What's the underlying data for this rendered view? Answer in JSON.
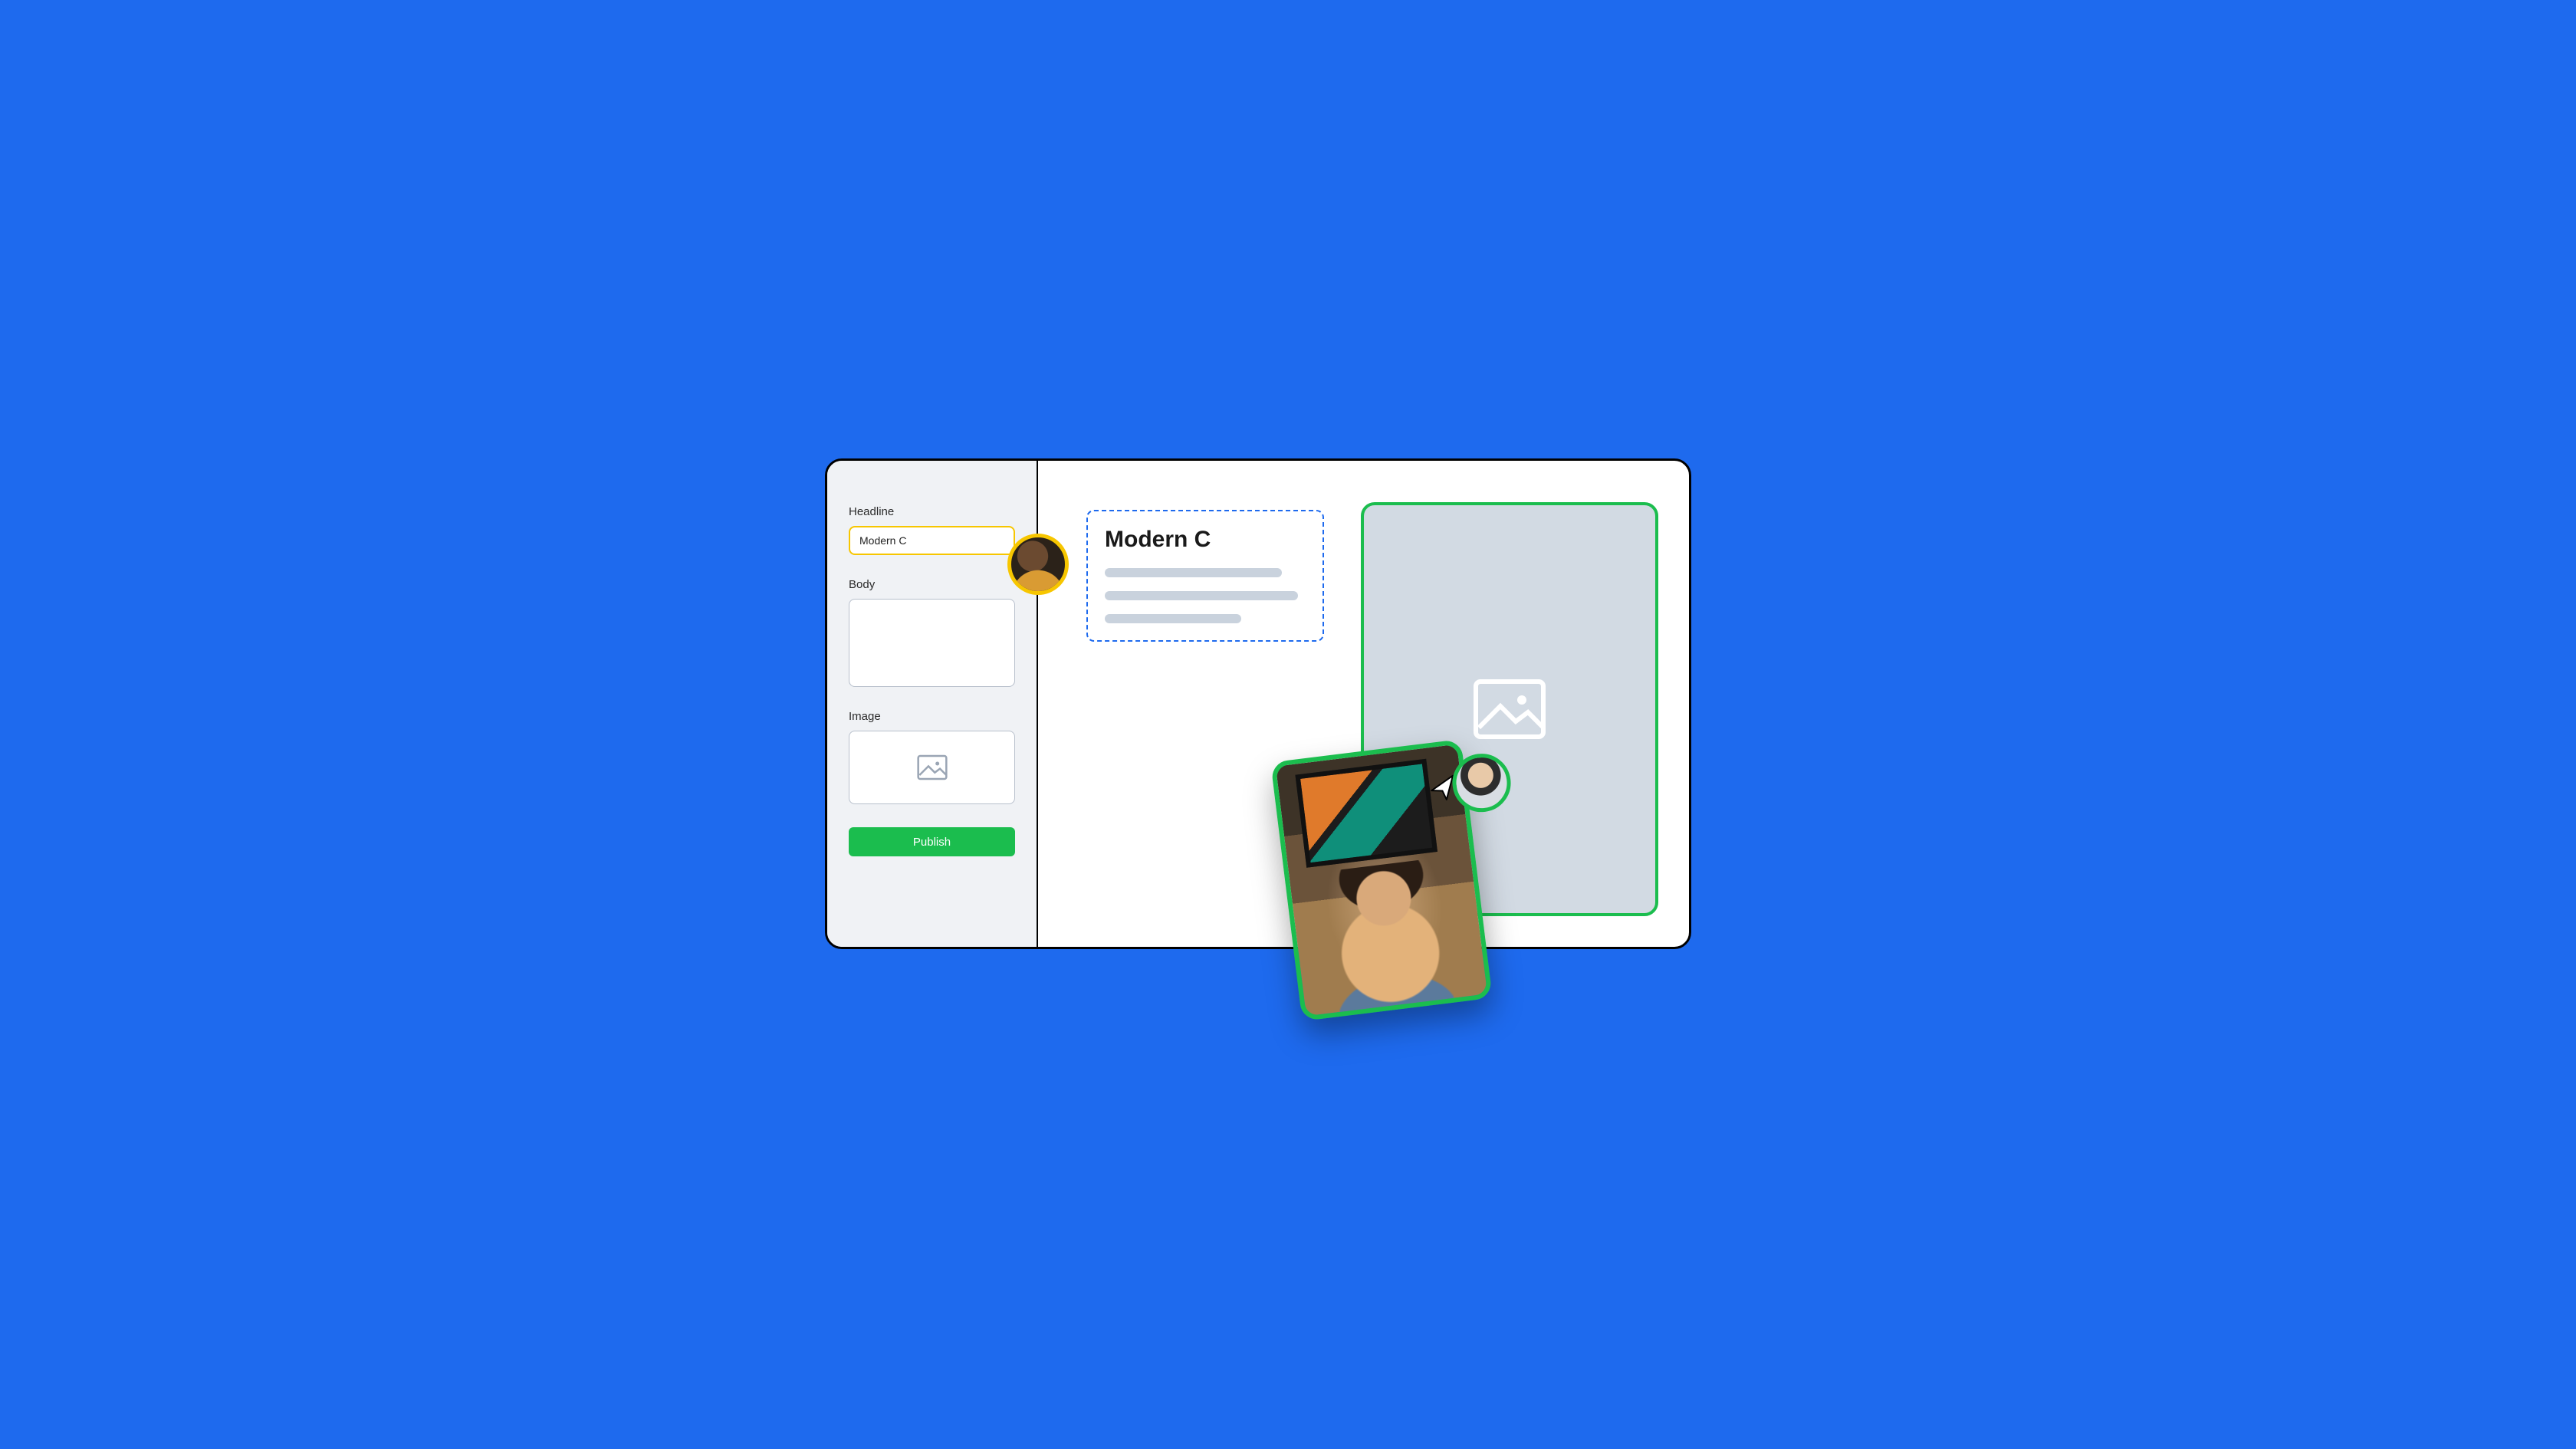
{
  "sidebar": {
    "headline_label": "Headline",
    "headline_value": "Modern C",
    "body_label": "Body",
    "body_value": "",
    "image_label": "Image",
    "publish_label": "Publish"
  },
  "preview": {
    "title": "Modern C"
  },
  "collaborators": {
    "editor_avatar": "user-1",
    "dragger_avatar": "user-2"
  },
  "colors": {
    "accent_blue": "#1E6AEE",
    "accent_green": "#1BBD4E",
    "accent_yellow": "#F7C600"
  }
}
